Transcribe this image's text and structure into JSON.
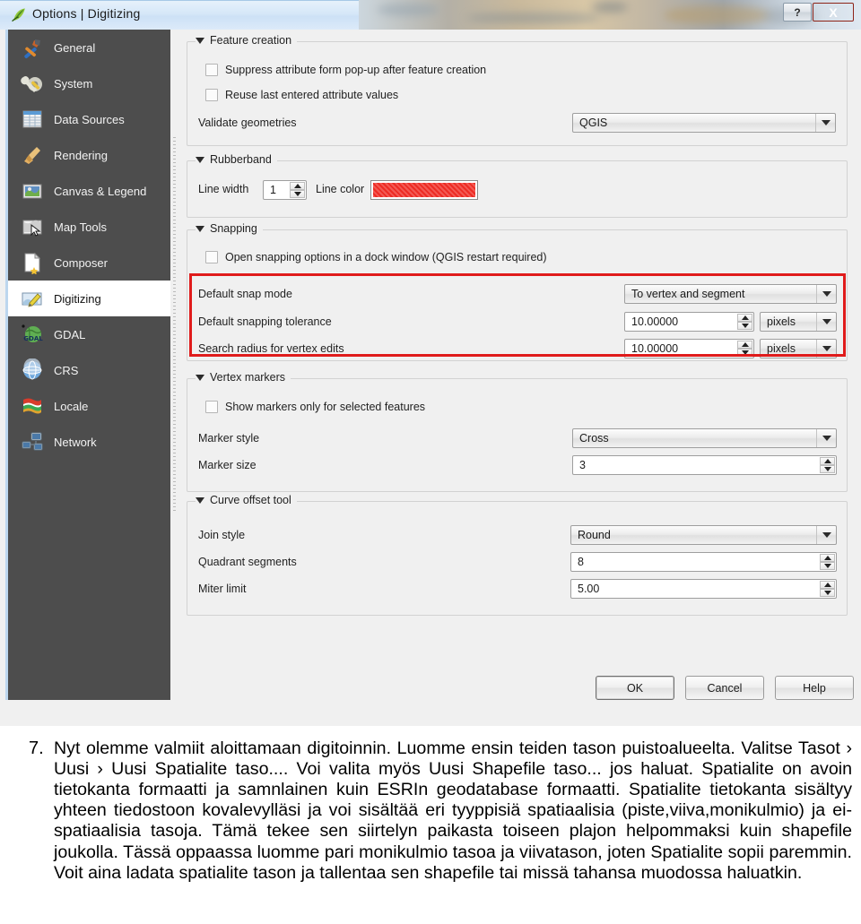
{
  "window": {
    "title": "Options | Digitizing",
    "logo_icon": "qgis-leaf-icon",
    "help_button": "?",
    "close_button": "X"
  },
  "sidebar": {
    "items": [
      {
        "label": "General",
        "icon": "hammer-screwdriver-icon",
        "selected": false
      },
      {
        "label": "System",
        "icon": "wrench-gear-icon",
        "selected": false
      },
      {
        "label": "Data Sources",
        "icon": "table-grid-icon",
        "selected": false
      },
      {
        "label": "Rendering",
        "icon": "paintbrush-icon",
        "selected": false
      },
      {
        "label": "Canvas & Legend",
        "icon": "map-canvas-icon",
        "selected": false
      },
      {
        "label": "Map Tools",
        "icon": "map-cursor-icon",
        "selected": false
      },
      {
        "label": "Composer",
        "icon": "page-star-icon",
        "selected": false
      },
      {
        "label": "Digitizing",
        "icon": "map-pencil-icon",
        "selected": true
      },
      {
        "label": "GDAL",
        "icon": "gdal-globe-icon",
        "selected": false
      },
      {
        "label": "CRS",
        "icon": "crs-globe-icon",
        "selected": false
      },
      {
        "label": "Locale",
        "icon": "flags-icon",
        "selected": false
      },
      {
        "label": "Network",
        "icon": "network-computers-icon",
        "selected": false
      }
    ]
  },
  "groups": {
    "feature_creation": {
      "title": "Feature creation",
      "suppress_label": "Suppress attribute form pop-up after feature creation",
      "suppress_checked": false,
      "reuse_label": "Reuse last entered attribute values",
      "reuse_checked": false,
      "validate_label": "Validate geometries",
      "validate_value": "QGIS"
    },
    "rubberband": {
      "title": "Rubberband",
      "line_width_label": "Line width",
      "line_width_value": "1",
      "line_color_label": "Line color",
      "line_color_hex": "#ee2b24"
    },
    "snapping": {
      "title": "Snapping",
      "dock_label": "Open snapping options in a dock window (QGIS restart required)",
      "dock_checked": false,
      "snap_mode_label": "Default snap mode",
      "snap_mode_value": "To vertex and segment",
      "tolerance_label": "Default snapping tolerance",
      "tolerance_value": "10.00000",
      "tolerance_units": "pixels",
      "search_radius_label": "Search radius for vertex edits",
      "search_radius_value": "10.00000",
      "search_radius_units": "pixels",
      "highlight_color": "#e01b1b"
    },
    "vertex_markers": {
      "title": "Vertex markers",
      "show_only_label": "Show markers only for selected features",
      "show_only_checked": false,
      "marker_style_label": "Marker style",
      "marker_style_value": "Cross",
      "marker_size_label": "Marker size",
      "marker_size_value": "3"
    },
    "curve_offset": {
      "title": "Curve offset tool",
      "join_style_label": "Join style",
      "join_style_value": "Round",
      "quadrant_label": "Quadrant segments",
      "quadrant_value": "8",
      "miter_label": "Miter limit",
      "miter_value": "5.00"
    }
  },
  "footer": {
    "ok": "OK",
    "cancel": "Cancel",
    "help": "Help"
  },
  "caption": {
    "number": "7.",
    "text": "Nyt olemme valmiit aloittamaan digitoinnin. Luomme ensin teiden tason puistoalueelta. Valitse Tasot › Uusi › Uusi Spatialite taso.... Voi valita myös Uusi Shapefile taso... jos haluat. Spatialite on avoin tietokanta formaatti ja samnlainen kuin ESRIn geodatabase formaatti. Spatialite tietokanta sisältyy yhteen tiedostoon kovalevylläsi ja voi sisältää eri tyyppisiä spatiaalisia (piste,viiva,monikulmio) ja ei-spatiaalisia tasoja. Tämä tekee sen siirtelyn paikasta toiseen plajon helpommaksi kuin shapefile joukolla. Tässä oppaassa luomme pari monikulmio tasoa ja viivatason, joten Spatialite sopii paremmin. Voit aina ladata spatialite tason ja tallentaa sen shapefile tai missä tahansa muodossa haluatkin."
  }
}
